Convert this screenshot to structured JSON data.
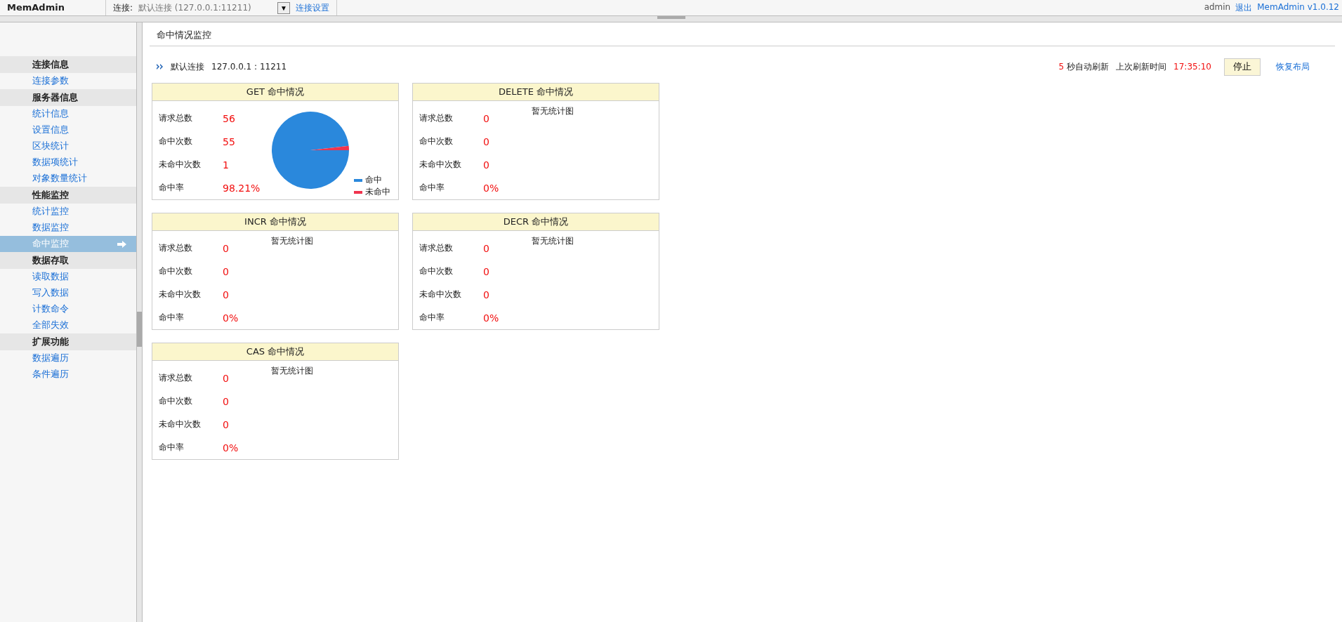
{
  "top_bar": {
    "app_name": "MemAdmin",
    "connection_label": "连接:",
    "connection_value": "默认连接 (127.0.0.1:11211)",
    "dropdown_glyph": "▼",
    "settings_link": "连接设置",
    "user": "admin",
    "logout": "退出",
    "version": "MemAdmin v1.0.12"
  },
  "sidebar": {
    "groups": [
      {
        "title": "连接信息",
        "items": [
          {
            "label": "连接参数",
            "selected": false
          }
        ]
      },
      {
        "title": "服务器信息",
        "items": [
          {
            "label": "统计信息",
            "selected": false
          },
          {
            "label": "设置信息",
            "selected": false
          },
          {
            "label": "区块统计",
            "selected": false
          },
          {
            "label": "数据项统计",
            "selected": false
          },
          {
            "label": "对象数量统计",
            "selected": false
          }
        ]
      },
      {
        "title": "性能监控",
        "items": [
          {
            "label": "统计监控",
            "selected": false
          },
          {
            "label": "数据监控",
            "selected": false
          },
          {
            "label": "命中监控",
            "selected": true
          }
        ]
      },
      {
        "title": "数据存取",
        "items": [
          {
            "label": "读取数据",
            "selected": false
          },
          {
            "label": "写入数据",
            "selected": false
          },
          {
            "label": "计数命令",
            "selected": false
          },
          {
            "label": "全部失效",
            "selected": false
          }
        ]
      },
      {
        "title": "扩展功能",
        "items": [
          {
            "label": "数据遍历",
            "selected": false
          },
          {
            "label": "条件遍历",
            "selected": false
          }
        ]
      }
    ]
  },
  "page": {
    "title": "命中情况监控",
    "connection_name": "默认连接",
    "connection_address": "127.0.0.1 : 11211",
    "refresh_seconds": "5",
    "refresh_label": "秒自动刷新",
    "last_refresh_label": "上次刷新时间",
    "last_refresh_time": "17:35:10",
    "stop_button": "停止",
    "restore_layout_link": "恢复布局"
  },
  "panels": [
    {
      "title": "GET 命中情况",
      "kind": "pie",
      "stats": [
        {
          "label": "请求总数",
          "value": "56"
        },
        {
          "label": "命中次数",
          "value": "55"
        },
        {
          "label": "未命中次数",
          "value": "1"
        },
        {
          "label": "命中率",
          "value": "98.21%"
        }
      ],
      "chart_data": {
        "type": "pie",
        "categories": [
          "命中",
          "未命中"
        ],
        "values": [
          98.21,
          1.79
        ],
        "colors": [
          "#2a88dc",
          "#f0344e"
        ],
        "legend": true
      }
    },
    {
      "title": "DELETE 命中情况",
      "kind": "empty",
      "empty_text": "暂无统计图",
      "stats": [
        {
          "label": "请求总数",
          "value": "0"
        },
        {
          "label": "命中次数",
          "value": "0"
        },
        {
          "label": "未命中次数",
          "value": "0"
        },
        {
          "label": "命中率",
          "value": "0%"
        }
      ]
    },
    {
      "title": "INCR 命中情况",
      "kind": "empty",
      "empty_text": "暂无统计图",
      "stats": [
        {
          "label": "请求总数",
          "value": "0"
        },
        {
          "label": "命中次数",
          "value": "0"
        },
        {
          "label": "未命中次数",
          "value": "0"
        },
        {
          "label": "命中率",
          "value": "0%"
        }
      ]
    },
    {
      "title": "DECR 命中情况",
      "kind": "empty",
      "empty_text": "暂无统计图",
      "stats": [
        {
          "label": "请求总数",
          "value": "0"
        },
        {
          "label": "命中次数",
          "value": "0"
        },
        {
          "label": "未命中次数",
          "value": "0"
        },
        {
          "label": "命中率",
          "value": "0%"
        }
      ]
    },
    {
      "title": "CAS 命中情况",
      "kind": "empty",
      "empty_text": "暂无统计图",
      "stats": [
        {
          "label": "请求总数",
          "value": "0"
        },
        {
          "label": "命中次数",
          "value": "0"
        },
        {
          "label": "未命中次数",
          "value": "0"
        },
        {
          "label": "命中率",
          "value": "0%"
        }
      ]
    }
  ]
}
